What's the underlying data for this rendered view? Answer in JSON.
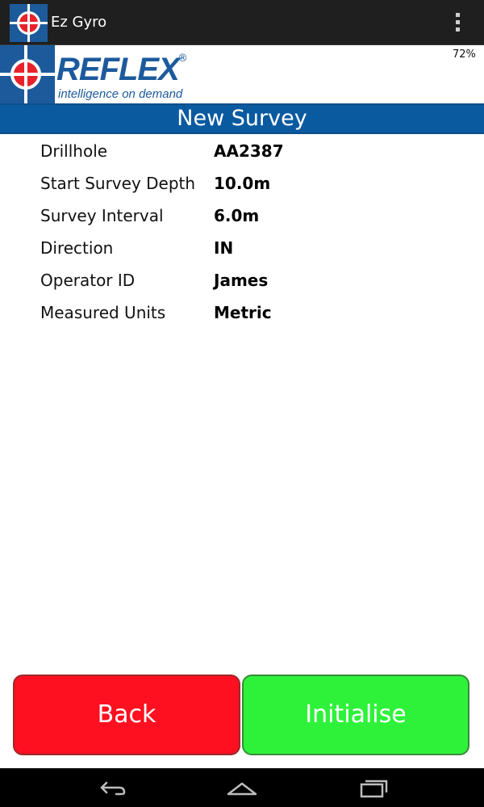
{
  "actionbar": {
    "app_title": "Ez Gyro",
    "app_icon": "reflex-crosshair-icon",
    "menu_icon": "overflow-menu-icon"
  },
  "header": {
    "brand": "REFLEX",
    "registered_mark": "®",
    "tagline": "intelligence on demand",
    "battery": "72%"
  },
  "screen": {
    "title": "New Survey"
  },
  "fields": [
    {
      "label": "Drillhole",
      "value": "AA2387"
    },
    {
      "label": "Start Survey Depth",
      "value": "10.0m"
    },
    {
      "label": "Survey Interval",
      "value": "6.0m"
    },
    {
      "label": "Direction",
      "value": "IN"
    },
    {
      "label": "Operator ID",
      "value": "James"
    },
    {
      "label": "Measured Units",
      "value": "Metric"
    }
  ],
  "buttons": {
    "back_label": "Back",
    "initialise_label": "Initialise"
  },
  "navbar": {
    "back_icon": "nav-back-icon",
    "home_icon": "nav-home-icon",
    "recents_icon": "nav-recents-icon"
  },
  "colors": {
    "brand_blue": "#1c5a9c",
    "title_bar": "#0a5aa0",
    "back_button": "#ff1020",
    "initialise_button": "#2ef23a"
  }
}
